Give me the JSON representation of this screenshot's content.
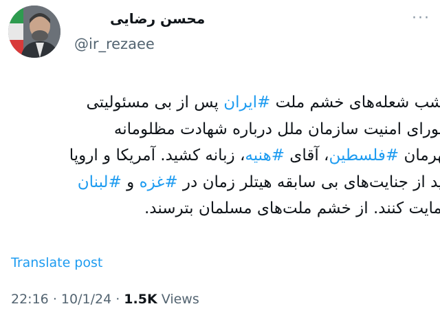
{
  "tweet": {
    "author_name": "محسن رضایی",
    "author_handle": "@ir_rezaee",
    "body_lines": [
      [
        {
          "text": "مشب شعله‌های خشم ملت ",
          "hashtag": false
        },
        {
          "text": "#ایران",
          "hashtag": true
        },
        {
          "text": " پس از بی مسئولیتی",
          "hashtag": false
        }
      ],
      [
        {
          "text": "شورای امنیت سازمان ملل درباره شهادت مظلومانه",
          "hashtag": false
        }
      ],
      [
        {
          "text": "قهرمان ",
          "hashtag": false
        },
        {
          "text": "#فلسطین",
          "hashtag": true
        },
        {
          "text": "، آقای ",
          "hashtag": false
        },
        {
          "text": "#هنیه",
          "hashtag": true
        },
        {
          "text": "، زبانه کشید. آمریکا و اروپا",
          "hashtag": false
        }
      ],
      [
        {
          "text": "باید از جنایت‌های بی سابقه هیتلر زمان در ",
          "hashtag": false
        },
        {
          "text": "#غزه",
          "hashtag": true
        },
        {
          "text": " و ",
          "hashtag": false
        },
        {
          "text": "#لبنان",
          "hashtag": true
        }
      ],
      [
        {
          "text": "حمایت کنند. از خشم ملت‌های مسلمان بترسند.",
          "hashtag": false
        }
      ]
    ],
    "translate_label": "Translate post",
    "time": "22:16",
    "date": "10/1/24",
    "separator": "·",
    "views_count": "1.5K",
    "views_label": "Views",
    "more_icon": "more-dots-icon"
  },
  "colors": {
    "link": "#1d9bf0",
    "secondary": "#536471",
    "text": "#0f1419"
  }
}
